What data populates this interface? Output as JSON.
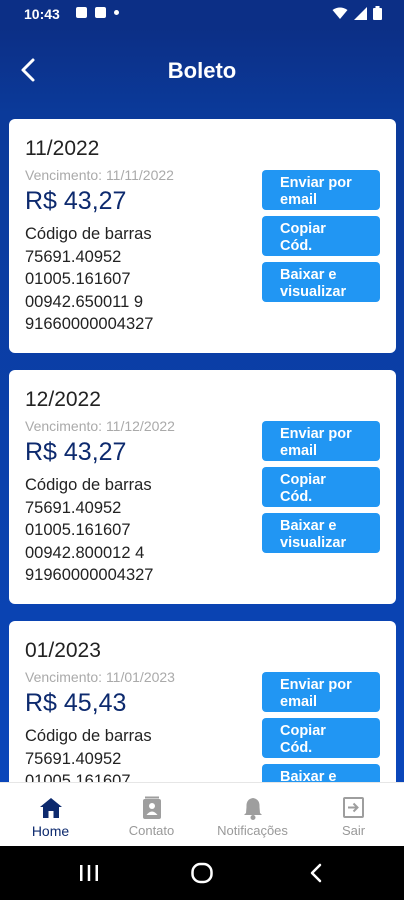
{
  "status": {
    "time": "10:43"
  },
  "header": {
    "title": "Boleto"
  },
  "cards": [
    {
      "period": "11/2022",
      "due": "Vencimento: 11/11/2022",
      "amount": "R$ 43,27",
      "barcode_label": "Código de barras",
      "barcode_lines": [
        "75691.40952",
        "01005.161607",
        "00942.650011 9",
        "91660000004327"
      ]
    },
    {
      "period": "12/2022",
      "due": "Vencimento: 11/12/2022",
      "amount": "R$ 43,27",
      "barcode_label": "Código de barras",
      "barcode_lines": [
        "75691.40952",
        "01005.161607",
        "00942.800012 4",
        "91960000004327"
      ]
    },
    {
      "period": "01/2023",
      "due": "Vencimento: 11/01/2023",
      "amount": "R$ 45,43",
      "barcode_label": "Código de barras",
      "barcode_lines": [
        "75691.40952",
        "01005.161607",
        "",
        ""
      ]
    }
  ],
  "buttons": {
    "email_line1": "Enviar por",
    "email_line2": "email",
    "copy_line1": "Copiar",
    "copy_line2": "Cód.",
    "download_line1": "Baixar e",
    "download_line2": "visualizar"
  },
  "bottom_nav": [
    {
      "label": "Home",
      "icon": "home-icon",
      "active": true
    },
    {
      "label": "Contato",
      "icon": "contact-card-icon",
      "active": false
    },
    {
      "label": "Notificações",
      "icon": "bell-icon",
      "active": false
    },
    {
      "label": "Sair",
      "icon": "logout-icon",
      "active": false
    }
  ],
  "colors": {
    "primary": "#0c2f86",
    "button": "#2196f3",
    "amount": "#0d2a6e"
  }
}
